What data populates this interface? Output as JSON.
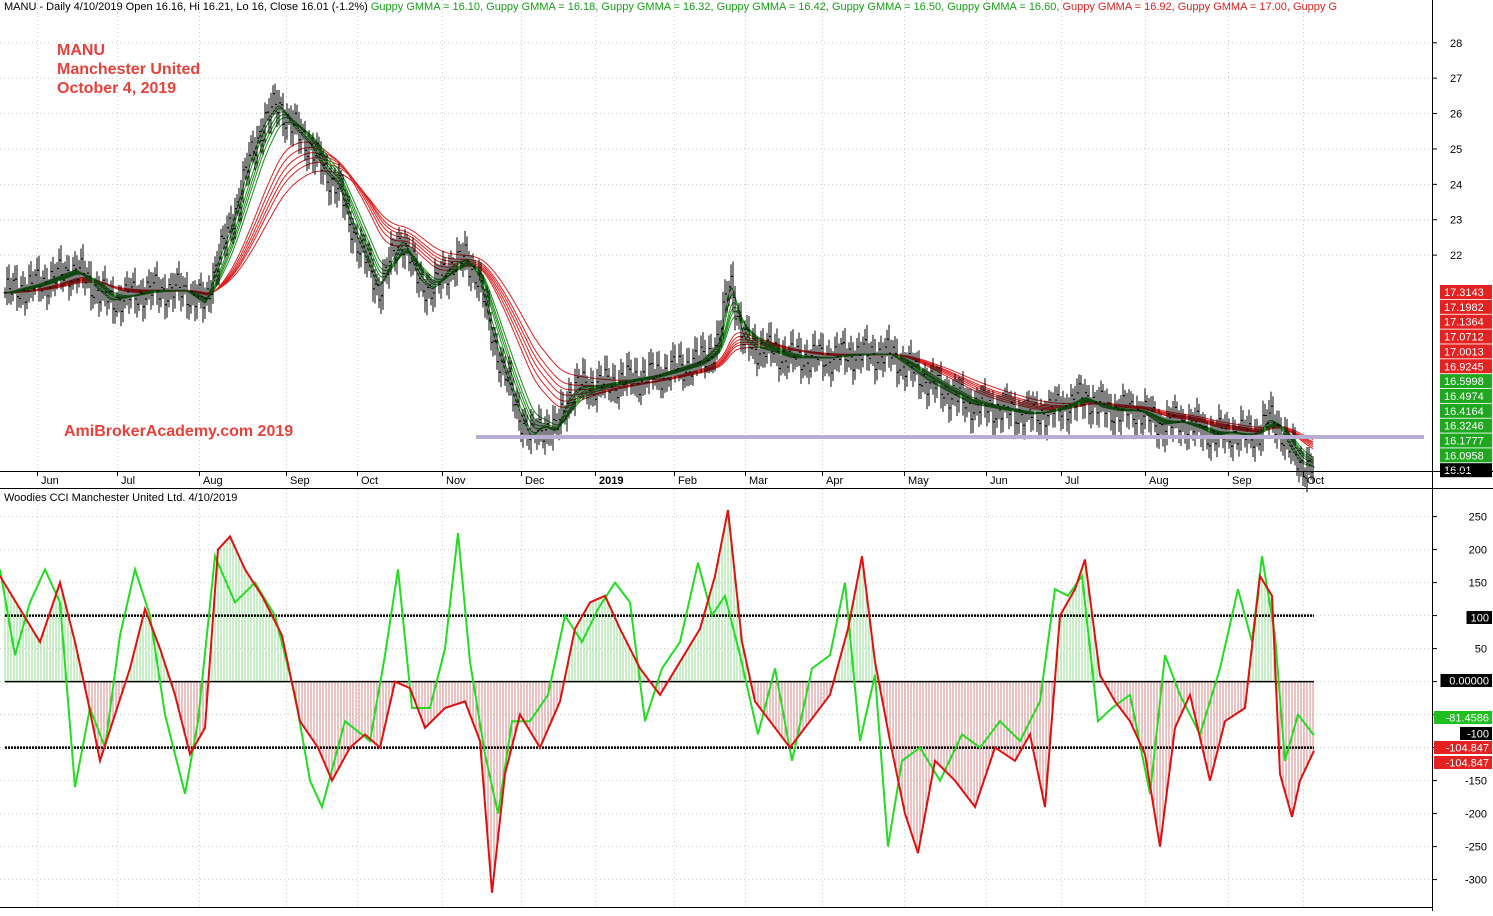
{
  "header": {
    "ticker_info": "MANU - Daily 4/10/2019 Open 16.16, Hi 16.21, Lo 16, Close 16.01 (-1.2%)",
    "gmma_labels": [
      {
        "text": "Guppy GMMA = 16.10,",
        "color": "#16a016"
      },
      {
        "text": "Guppy GMMA = 16.18,",
        "color": "#16a016"
      },
      {
        "text": "Guppy GMMA = 16.32,",
        "color": "#16a016"
      },
      {
        "text": "Guppy GMMA = 16.42,",
        "color": "#16a016"
      },
      {
        "text": "Guppy GMMA = 16.50,",
        "color": "#16a016"
      },
      {
        "text": "Guppy GMMA = 16.60,",
        "color": "#16a016"
      },
      {
        "text": "Guppy GMMA = 16.92,",
        "color": "#e02020"
      },
      {
        "text": "Guppy GMMA = 17.00,",
        "color": "#e02020"
      },
      {
        "text": "Guppy G",
        "color": "#e02020"
      }
    ]
  },
  "annotations": {
    "line1": "MANU",
    "line2": "Manchester United",
    "line3": "October 4, 2019",
    "watermark": "AmiBrokerAcademy.com  2019"
  },
  "lower_title": "Woodies CCI  Manchester United Ltd. 4/10/2019",
  "colors": {
    "short_ma": "#1a8c1a",
    "long_ma": "#e02020",
    "cci_fast": "#22dd22",
    "cci_slow": "#e01010",
    "support_line": "#b8aed2"
  },
  "chart_data": [
    {
      "type": "line",
      "name": "price-gmma",
      "y_ticks": [
        22,
        23,
        24,
        25,
        26,
        27,
        28
      ],
      "ylim": [
        15.9,
        28.7
      ],
      "month_labels": [
        "Jun",
        "Jul",
        "Aug",
        "Sep",
        "Oct",
        "Nov",
        "Dec",
        "2019",
        "Feb",
        "Mar",
        "Apr",
        "May",
        "Jun",
        "Jul",
        "Aug",
        "Sep",
        "Oct"
      ],
      "price_points": [
        [
          0,
          20.9
        ],
        [
          40,
          21.2
        ],
        [
          75,
          21.6
        ],
        [
          110,
          20.7
        ],
        [
          150,
          21.0
        ],
        [
          185,
          21.0
        ],
        [
          205,
          20.6
        ],
        [
          215,
          21.7
        ],
        [
          230,
          22.8
        ],
        [
          245,
          24.3
        ],
        [
          262,
          25.7
        ],
        [
          278,
          26.3
        ],
        [
          290,
          25.7
        ],
        [
          310,
          25.1
        ],
        [
          325,
          24.3
        ],
        [
          338,
          24.0
        ],
        [
          348,
          23.0
        ],
        [
          362,
          22.1
        ],
        [
          378,
          21.0
        ],
        [
          390,
          21.8
        ],
        [
          402,
          22.5
        ],
        [
          418,
          21.3
        ],
        [
          432,
          21.0
        ],
        [
          450,
          21.7
        ],
        [
          465,
          21.9
        ],
        [
          478,
          21.4
        ],
        [
          490,
          19.9
        ],
        [
          500,
          19.0
        ],
        [
          515,
          17.8
        ],
        [
          530,
          16.8
        ],
        [
          542,
          17.2
        ],
        [
          555,
          17.0
        ],
        [
          568,
          18.0
        ],
        [
          580,
          18.3
        ],
        [
          595,
          18.3
        ],
        [
          615,
          18.4
        ],
        [
          635,
          18.5
        ],
        [
          655,
          18.6
        ],
        [
          678,
          18.8
        ],
        [
          700,
          19.0
        ],
        [
          718,
          19.5
        ],
        [
          730,
          21.4
        ],
        [
          742,
          19.6
        ],
        [
          755,
          19.4
        ],
        [
          770,
          19.3
        ],
        [
          790,
          19.1
        ],
        [
          810,
          19.1
        ],
        [
          830,
          19.1
        ],
        [
          850,
          19.2
        ],
        [
          870,
          19.2
        ],
        [
          890,
          19.2
        ],
        [
          910,
          18.8
        ],
        [
          930,
          18.4
        ],
        [
          950,
          18.1
        ],
        [
          970,
          17.8
        ],
        [
          990,
          17.7
        ],
        [
          1010,
          17.6
        ],
        [
          1030,
          17.5
        ],
        [
          1050,
          17.6
        ],
        [
          1070,
          17.8
        ],
        [
          1085,
          18.0
        ],
        [
          1100,
          17.7
        ],
        [
          1120,
          17.6
        ],
        [
          1140,
          17.6
        ],
        [
          1160,
          17.2
        ],
        [
          1180,
          17.3
        ],
        [
          1200,
          17.1
        ],
        [
          1215,
          16.9
        ],
        [
          1230,
          17.0
        ],
        [
          1245,
          16.9
        ],
        [
          1260,
          17.0
        ],
        [
          1268,
          17.4
        ],
        [
          1278,
          17.2
        ],
        [
          1290,
          16.5
        ],
        [
          1300,
          16.1
        ],
        [
          1314,
          16.01
        ]
      ],
      "short_ma_values": [
        16.1,
        16.18,
        16.32,
        16.42,
        16.5,
        16.6
      ],
      "long_ma_values": [
        16.92,
        17.0,
        17.07,
        17.14,
        17.2,
        17.31
      ],
      "support_level": 16.86,
      "right_badges": [
        {
          "value": "17.3143",
          "color": "#e52222"
        },
        {
          "value": "17.1982",
          "color": "#e52222"
        },
        {
          "value": "17.1364",
          "color": "#e52222"
        },
        {
          "value": "17.0712",
          "color": "#e52222"
        },
        {
          "value": "17.0013",
          "color": "#e52222"
        },
        {
          "value": "16.9245",
          "color": "#e52222"
        },
        {
          "value": "16.5998",
          "color": "#1fa81f"
        },
        {
          "value": "16.4974",
          "color": "#1fa81f"
        },
        {
          "value": "16.4164",
          "color": "#1fa81f"
        },
        {
          "value": "16.3246",
          "color": "#1fa81f"
        },
        {
          "value": "16.1777",
          "color": "#1fa81f"
        },
        {
          "value": "16.0958",
          "color": "#1fa81f"
        },
        {
          "value": "16.01",
          "color": "#000000"
        }
      ]
    },
    {
      "type": "line",
      "name": "woodies-cci",
      "y_ticks": [
        -300,
        -250,
        -200,
        -150,
        -100,
        -50,
        0,
        50,
        100,
        150,
        200,
        250
      ],
      "ylim": [
        -340,
        260
      ],
      "reference_lines": [
        100,
        0,
        -100
      ],
      "cci_slow_points": [
        [
          0,
          160
        ],
        [
          20,
          110
        ],
        [
          40,
          60
        ],
        [
          60,
          150
        ],
        [
          75,
          60
        ],
        [
          88,
          -30
        ],
        [
          100,
          -120
        ],
        [
          115,
          -50
        ],
        [
          130,
          20
        ],
        [
          145,
          110
        ],
        [
          160,
          50
        ],
        [
          175,
          -20
        ],
        [
          190,
          -110
        ],
        [
          205,
          -70
        ],
        [
          218,
          200
        ],
        [
          230,
          220
        ],
        [
          245,
          170
        ],
        [
          262,
          130
        ],
        [
          282,
          70
        ],
        [
          300,
          -60
        ],
        [
          318,
          -100
        ],
        [
          332,
          -150
        ],
        [
          350,
          -100
        ],
        [
          365,
          -80
        ],
        [
          380,
          -100
        ],
        [
          395,
          0
        ],
        [
          410,
          -10
        ],
        [
          425,
          -70
        ],
        [
          445,
          -40
        ],
        [
          465,
          -30
        ],
        [
          480,
          -90
        ],
        [
          492,
          -320
        ],
        [
          505,
          -140
        ],
        [
          520,
          -50
        ],
        [
          540,
          -100
        ],
        [
          560,
          -30
        ],
        [
          575,
          80
        ],
        [
          590,
          120
        ],
        [
          605,
          130
        ],
        [
          620,
          80
        ],
        [
          640,
          20
        ],
        [
          660,
          -20
        ],
        [
          680,
          30
        ],
        [
          700,
          80
        ],
        [
          715,
          160
        ],
        [
          728,
          260
        ],
        [
          742,
          60
        ],
        [
          755,
          -30
        ],
        [
          770,
          -60
        ],
        [
          790,
          -100
        ],
        [
          810,
          -60
        ],
        [
          830,
          -20
        ],
        [
          848,
          80
        ],
        [
          862,
          190
        ],
        [
          875,
          30
        ],
        [
          890,
          -90
        ],
        [
          905,
          -200
        ],
        [
          918,
          -260
        ],
        [
          935,
          -120
        ],
        [
          955,
          -150
        ],
        [
          975,
          -190
        ],
        [
          995,
          -100
        ],
        [
          1015,
          -120
        ],
        [
          1030,
          -80
        ],
        [
          1045,
          -190
        ],
        [
          1060,
          100
        ],
        [
          1075,
          140
        ],
        [
          1085,
          185
        ],
        [
          1100,
          10
        ],
        [
          1115,
          -30
        ],
        [
          1130,
          -60
        ],
        [
          1145,
          -110
        ],
        [
          1160,
          -250
        ],
        [
          1175,
          -70
        ],
        [
          1190,
          -20
        ],
        [
          1210,
          -150
        ],
        [
          1225,
          -60
        ],
        [
          1245,
          -40
        ],
        [
          1260,
          160
        ],
        [
          1272,
          130
        ],
        [
          1280,
          -140
        ],
        [
          1292,
          -205
        ],
        [
          1300,
          -150
        ],
        [
          1314,
          -104.8
        ]
      ],
      "cci_fast_points": [
        [
          0,
          170
        ],
        [
          15,
          40
        ],
        [
          30,
          120
        ],
        [
          45,
          170
        ],
        [
          60,
          120
        ],
        [
          75,
          -160
        ],
        [
          90,
          -40
        ],
        [
          105,
          -100
        ],
        [
          120,
          70
        ],
        [
          135,
          170
        ],
        [
          150,
          100
        ],
        [
          165,
          -50
        ],
        [
          185,
          -170
        ],
        [
          198,
          -60
        ],
        [
          215,
          190
        ],
        [
          235,
          120
        ],
        [
          255,
          150
        ],
        [
          275,
          100
        ],
        [
          295,
          -20
        ],
        [
          310,
          -150
        ],
        [
          322,
          -190
        ],
        [
          345,
          -60
        ],
        [
          370,
          -90
        ],
        [
          385,
          40
        ],
        [
          398,
          170
        ],
        [
          412,
          -40
        ],
        [
          430,
          -40
        ],
        [
          445,
          50
        ],
        [
          458,
          225
        ],
        [
          470,
          30
        ],
        [
          485,
          -110
        ],
        [
          498,
          -200
        ],
        [
          512,
          -60
        ],
        [
          530,
          -60
        ],
        [
          548,
          -20
        ],
        [
          565,
          100
        ],
        [
          582,
          60
        ],
        [
          598,
          110
        ],
        [
          615,
          150
        ],
        [
          630,
          120
        ],
        [
          645,
          -60
        ],
        [
          662,
          20
        ],
        [
          680,
          60
        ],
        [
          698,
          180
        ],
        [
          712,
          100
        ],
        [
          725,
          130
        ],
        [
          740,
          40
        ],
        [
          758,
          -80
        ],
        [
          775,
          20
        ],
        [
          792,
          -120
        ],
        [
          812,
          20
        ],
        [
          830,
          40
        ],
        [
          845,
          150
        ],
        [
          860,
          -90
        ],
        [
          875,
          10
        ],
        [
          888,
          -250
        ],
        [
          902,
          -120
        ],
        [
          920,
          -100
        ],
        [
          940,
          -150
        ],
        [
          962,
          -80
        ],
        [
          980,
          -100
        ],
        [
          1000,
          -60
        ],
        [
          1020,
          -90
        ],
        [
          1040,
          -30
        ],
        [
          1055,
          140
        ],
        [
          1068,
          130
        ],
        [
          1082,
          160
        ],
        [
          1098,
          -60
        ],
        [
          1112,
          -40
        ],
        [
          1130,
          -20
        ],
        [
          1150,
          -170
        ],
        [
          1165,
          40
        ],
        [
          1180,
          -20
        ],
        [
          1200,
          -80
        ],
        [
          1220,
          20
        ],
        [
          1238,
          140
        ],
        [
          1252,
          60
        ],
        [
          1262,
          190
        ],
        [
          1275,
          70
        ],
        [
          1285,
          -120
        ],
        [
          1298,
          -50
        ],
        [
          1314,
          -81.5
        ]
      ],
      "right_badges": [
        {
          "value": "100",
          "bg": "#000000",
          "fg": "#ffffff",
          "level": 100
        },
        {
          "value": "0.00000",
          "bg": "#000000",
          "fg": "#ffffff",
          "level": 0
        },
        {
          "value": "-81.4586",
          "bg": "#1fbf1f",
          "fg": "#ffffff",
          "level": -81.4586
        },
        {
          "value": "-100",
          "bg": "#000000",
          "fg": "#ffffff",
          "level": -100
        },
        {
          "value": "-104.847",
          "bg": "#e52222",
          "fg": "#ffffff",
          "level": -104.847
        },
        {
          "value": "-104.847",
          "bg": "#e52222",
          "fg": "#ffffff",
          "level": -104.847
        }
      ]
    }
  ]
}
